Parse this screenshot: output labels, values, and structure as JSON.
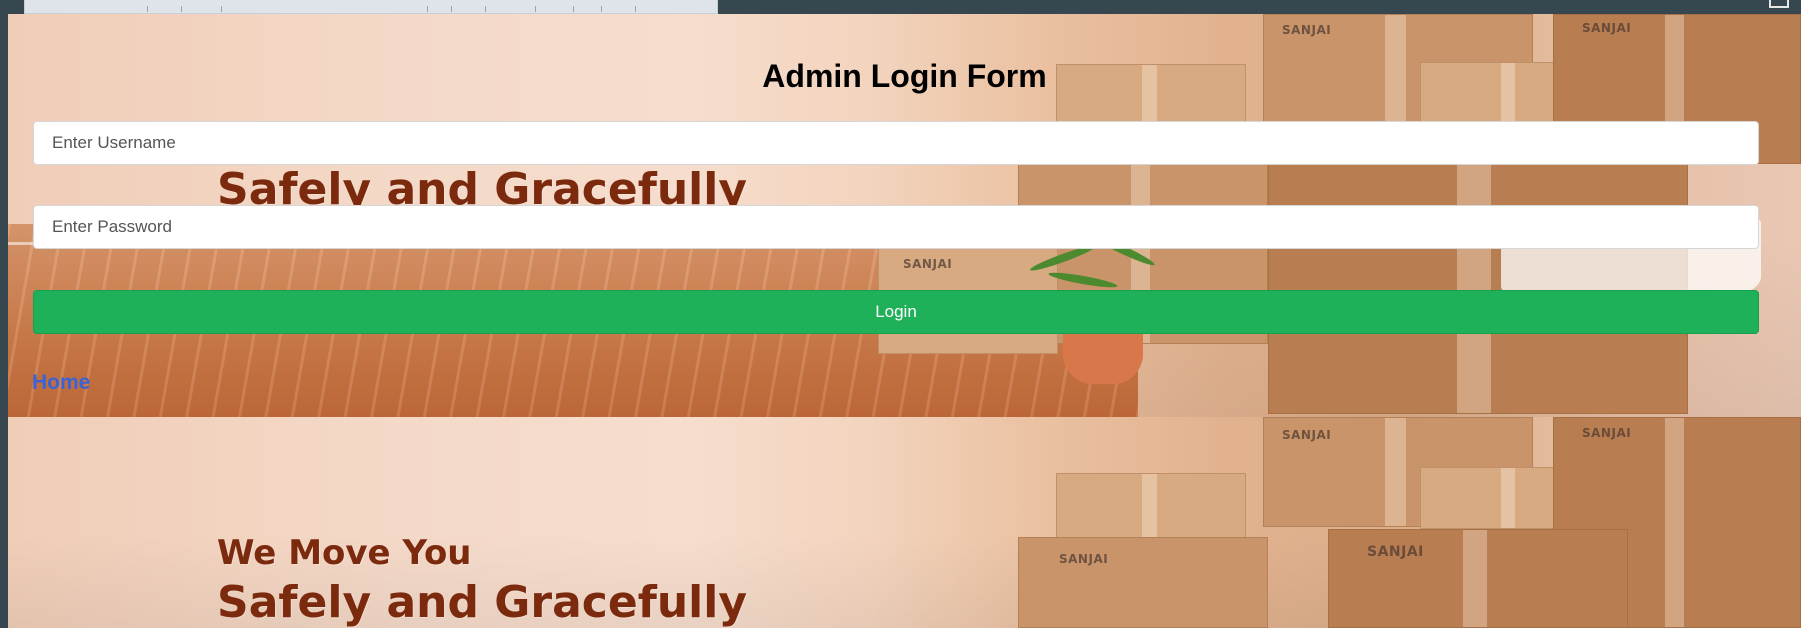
{
  "form": {
    "title": "Admin Login Form",
    "username_placeholder": "Enter Username",
    "password_placeholder": "Enter Password",
    "login_label": "Login",
    "home_link": "Home"
  },
  "hero": {
    "line1": "We Move You",
    "line2": "Safely and Gracefully",
    "brand": "SANJAI"
  },
  "colors": {
    "login_button": "#1fb05a",
    "home_link": "#3a63d8",
    "headline": "#7b2a0e",
    "page_frame": "#37474f"
  }
}
